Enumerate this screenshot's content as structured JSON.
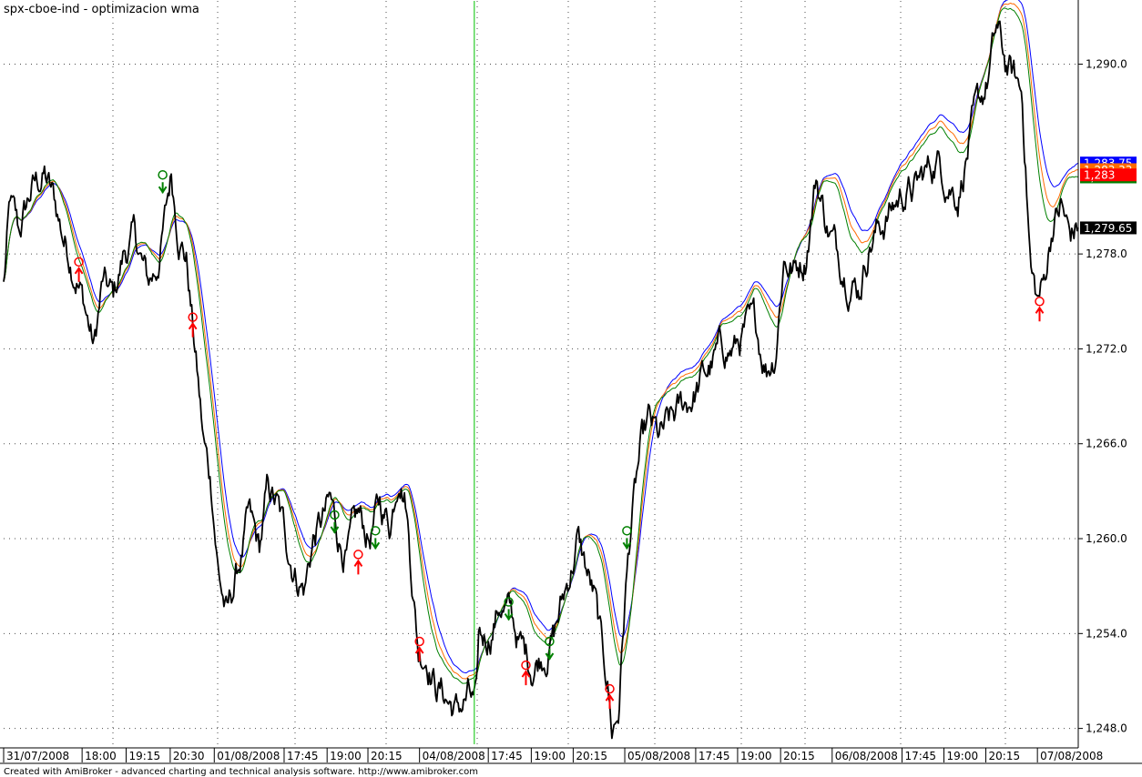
{
  "chart_title": "spx-cboe-ind - optimizacion wma",
  "footer_text": "Created with AmiBroker - advanced charting and technical analysis software. http://www.amibroker.com",
  "colors": {
    "price": "#000000",
    "wma_blue": "#0000ff",
    "wma_orange": "#ff6a00",
    "wma_green": "#008000",
    "cursor_line": "#00c000",
    "buy_signal": "#008000",
    "sell_signal": "#ff0000",
    "grid": "#000000"
  },
  "chart_data": {
    "type": "line",
    "y_axis": {
      "min": 1247,
      "max": 1294,
      "ticks": [
        1248,
        1254,
        1260,
        1266,
        1272,
        1278,
        1290
      ],
      "tick_labels": [
        "1,248.0",
        "1,254.0",
        "1,260.0",
        "1,266.0",
        "1,272.0",
        "1,278.0",
        "1,290.0"
      ]
    },
    "x_axis": {
      "bar_count": 1000,
      "labels": [
        {
          "bar": 0,
          "text": "31/07/2008"
        },
        {
          "bar": 73,
          "text": "18:00"
        },
        {
          "bar": 114,
          "text": "19:15"
        },
        {
          "bar": 155,
          "text": "20:30"
        },
        {
          "bar": 196,
          "text": "01/08/2008"
        },
        {
          "bar": 261,
          "text": "17:45"
        },
        {
          "bar": 301,
          "text": "19:00"
        },
        {
          "bar": 339,
          "text": "20:15"
        },
        {
          "bar": 387,
          "text": "04/08/2008"
        },
        {
          "bar": 451,
          "text": "17:45"
        },
        {
          "bar": 491,
          "text": "19:00"
        },
        {
          "bar": 530,
          "text": "20:15"
        },
        {
          "bar": 578,
          "text": "05/08/2008"
        },
        {
          "bar": 644,
          "text": "17:45"
        },
        {
          "bar": 683,
          "text": "19:00"
        },
        {
          "bar": 723,
          "text": "20:15"
        },
        {
          "bar": 771,
          "text": "06/08/2008"
        },
        {
          "bar": 836,
          "text": "17:45"
        },
        {
          "bar": 875,
          "text": "19:00"
        },
        {
          "bar": 914,
          "text": "20:15"
        },
        {
          "bar": 962,
          "text": "07/08/2008"
        }
      ]
    },
    "price_keypoints": [
      [
        0,
        1276
      ],
      [
        6,
        1281
      ],
      [
        14,
        1279
      ],
      [
        26,
        1282
      ],
      [
        38,
        1283
      ],
      [
        48,
        1281
      ],
      [
        56,
        1279
      ],
      [
        68,
        1277
      ],
      [
        78,
        1274
      ],
      [
        84,
        1272
      ],
      [
        92,
        1276
      ],
      [
        102,
        1275
      ],
      [
        112,
        1278
      ],
      [
        122,
        1279
      ],
      [
        134,
        1276
      ],
      [
        142,
        1277
      ],
      [
        150,
        1280
      ],
      [
        156,
        1283
      ],
      [
        162,
        1280
      ],
      [
        170,
        1278
      ],
      [
        178,
        1272
      ],
      [
        186,
        1266
      ],
      [
        194,
        1263
      ],
      [
        200,
        1258
      ],
      [
        208,
        1255
      ],
      [
        218,
        1258
      ],
      [
        228,
        1261
      ],
      [
        238,
        1259
      ],
      [
        246,
        1263
      ],
      [
        254,
        1262
      ],
      [
        262,
        1260
      ],
      [
        272,
        1258
      ],
      [
        280,
        1257
      ],
      [
        288,
        1260
      ],
      [
        296,
        1261
      ],
      [
        304,
        1262
      ],
      [
        312,
        1260
      ],
      [
        320,
        1259
      ],
      [
        330,
        1261
      ],
      [
        340,
        1260
      ],
      [
        350,
        1262
      ],
      [
        360,
        1261
      ],
      [
        368,
        1265
      ],
      [
        374,
        1263
      ],
      [
        380,
        1258
      ],
      [
        386,
        1253
      ],
      [
        394,
        1253
      ],
      [
        402,
        1251
      ],
      [
        412,
        1250
      ],
      [
        422,
        1249
      ],
      [
        432,
        1250
      ],
      [
        440,
        1249
      ],
      [
        442,
        1253
      ],
      [
        452,
        1254
      ],
      [
        462,
        1256
      ],
      [
        472,
        1255
      ],
      [
        482,
        1253
      ],
      [
        492,
        1252
      ],
      [
        502,
        1253
      ],
      [
        512,
        1254
      ],
      [
        524,
        1257
      ],
      [
        534,
        1260
      ],
      [
        542,
        1258
      ],
      [
        550,
        1256
      ],
      [
        556,
        1253
      ],
      [
        562,
        1251
      ],
      [
        566,
        1248
      ],
      [
        572,
        1249
      ],
      [
        578,
        1256
      ],
      [
        584,
        1261
      ],
      [
        592,
        1265
      ],
      [
        600,
        1267
      ],
      [
        610,
        1266
      ],
      [
        620,
        1267
      ],
      [
        630,
        1268
      ],
      [
        640,
        1269
      ],
      [
        650,
        1270
      ],
      [
        660,
        1271
      ],
      [
        670,
        1272
      ],
      [
        680,
        1272
      ],
      [
        690,
        1273
      ],
      [
        700,
        1273
      ],
      [
        710,
        1271
      ],
      [
        718,
        1272
      ],
      [
        726,
        1278
      ],
      [
        736,
        1277
      ],
      [
        746,
        1278
      ],
      [
        756,
        1283
      ],
      [
        766,
        1280
      ],
      [
        776,
        1278
      ],
      [
        786,
        1277
      ],
      [
        796,
        1276
      ],
      [
        806,
        1279
      ],
      [
        818,
        1280
      ],
      [
        828,
        1281
      ],
      [
        838,
        1282
      ],
      [
        848,
        1282
      ],
      [
        858,
        1283
      ],
      [
        868,
        1284
      ],
      [
        878,
        1283
      ],
      [
        888,
        1282
      ],
      [
        898,
        1285
      ],
      [
        908,
        1287
      ],
      [
        916,
        1289
      ],
      [
        924,
        1292
      ],
      [
        932,
        1290
      ],
      [
        940,
        1289
      ],
      [
        948,
        1288
      ],
      [
        956,
        1277
      ],
      [
        962,
        1275
      ],
      [
        968,
        1276
      ],
      [
        976,
        1280
      ],
      [
        984,
        1281
      ],
      [
        992,
        1279
      ],
      [
        1000,
        1279.65
      ]
    ],
    "series": [
      {
        "name": "",
        "color": "#0000ff",
        "last_value": 1283.75,
        "tag_label": "1,283.75",
        "tag_color": "#0000ff"
      },
      {
        "name": "",
        "color": "#ff6a00",
        "last_value": 1283.33,
        "tag_label": "1,283.33",
        "tag_color": "#ff6a00"
      },
      {
        "name": "",
        "color": "#008000",
        "last_value": 1282.87,
        "tag_label": "1,282.87",
        "tag_color": "#008000"
      }
    ],
    "price_tags": [
      {
        "value": 1283,
        "label": "1,283",
        "color": "#ff0000"
      },
      {
        "value": 1279.65,
        "label": "1,279.65",
        "color": "#000000"
      }
    ],
    "cursor_bar": 438,
    "buy_signals": [
      {
        "bar": 148,
        "price": 1283.0
      },
      {
        "bar": 308,
        "price": 1261.5
      },
      {
        "bar": 346,
        "price": 1260.5
      },
      {
        "bar": 470,
        "price": 1256.0
      },
      {
        "bar": 508,
        "price": 1253.5
      },
      {
        "bar": 580,
        "price": 1260.5
      }
    ],
    "sell_signals": [
      {
        "bar": 70,
        "price": 1277.5
      },
      {
        "bar": 176,
        "price": 1274.0
      },
      {
        "bar": 330,
        "price": 1259.0
      },
      {
        "bar": 387,
        "price": 1253.5
      },
      {
        "bar": 486,
        "price": 1252.0
      },
      {
        "bar": 564,
        "price": 1250.5
      },
      {
        "bar": 964,
        "price": 1275.0
      }
    ]
  }
}
